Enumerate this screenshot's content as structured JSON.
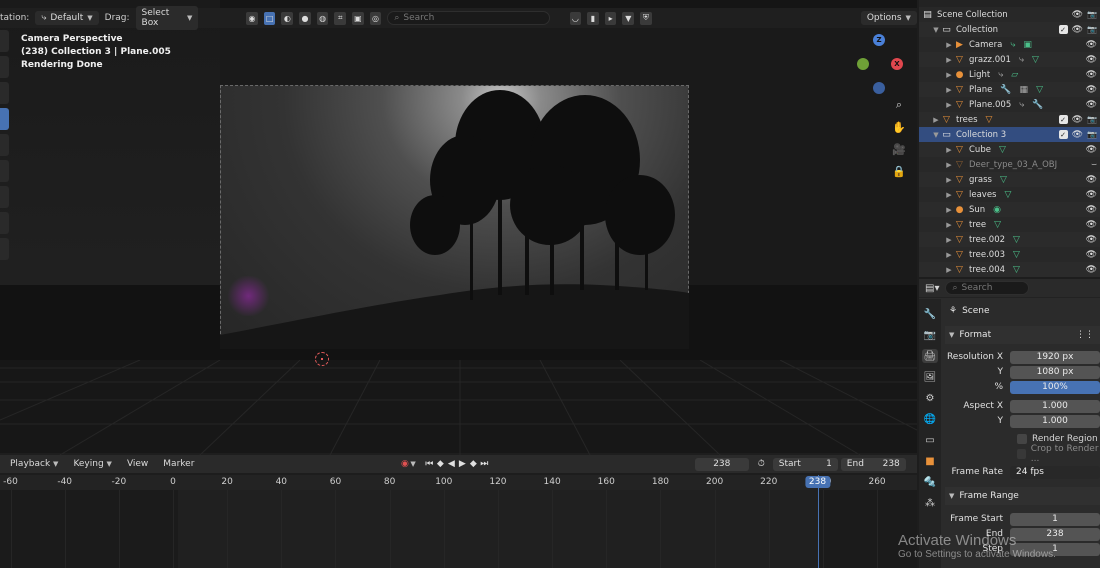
{
  "viewport": {
    "header": {
      "orientation_label": "tation:",
      "orientation_value": "Default",
      "drag_label": "Drag:",
      "drag_value": "Select Box",
      "search_placeholder": "Search",
      "options_label": "Options"
    },
    "overlay": {
      "line1": "Camera Perspective",
      "line2": "(238) Collection 3 | Plane.005",
      "line3": "Rendering Done"
    },
    "gizmo": {
      "z": "Z",
      "x": "X",
      "y": "Y"
    }
  },
  "timeline": {
    "menus": [
      "Playback",
      "Keying",
      "View",
      "Marker"
    ],
    "current_frame": "238",
    "start_label": "Start",
    "start_value": "1",
    "end_label": "End",
    "end_value": "238",
    "ruler_ticks": [
      "-60",
      "-40",
      "-20",
      "0",
      "20",
      "40",
      "60",
      "80",
      "100",
      "120",
      "140",
      "160",
      "180",
      "200",
      "220",
      "240",
      "260"
    ],
    "playhead": "238"
  },
  "outliner": {
    "search_placeholder": "Search",
    "rows": [
      {
        "label": "Scene Collection",
        "type": "scene"
      },
      {
        "label": "Collection",
        "type": "collection"
      },
      {
        "label": "Camera",
        "type": "camera"
      },
      {
        "label": "grazz.001",
        "type": "mesh"
      },
      {
        "label": "Light",
        "type": "light"
      },
      {
        "label": "Plane",
        "type": "mesh"
      },
      {
        "label": "Plane.005",
        "type": "mesh"
      },
      {
        "label": "trees",
        "type": "mesh"
      },
      {
        "label": "Collection 3",
        "type": "collection"
      },
      {
        "label": "Cube",
        "type": "mesh"
      },
      {
        "label": "Deer_type_03_A_OBJ",
        "type": "mesh"
      },
      {
        "label": "grass",
        "type": "mesh"
      },
      {
        "label": "leaves",
        "type": "mesh"
      },
      {
        "label": "Sun",
        "type": "light"
      },
      {
        "label": "tree",
        "type": "mesh"
      },
      {
        "label": "tree.002",
        "type": "mesh"
      },
      {
        "label": "tree.003",
        "type": "mesh"
      },
      {
        "label": "tree.004",
        "type": "mesh"
      }
    ]
  },
  "properties": {
    "search_placeholder": "Search",
    "scene_label": "Scene",
    "format_section": "Format",
    "resolution_x_label": "Resolution X",
    "resolution_x": "1920 px",
    "y_label": "Y",
    "resolution_y": "1080 px",
    "percent_label": "%",
    "percent": "100%",
    "aspect_x_label": "Aspect X",
    "aspect_x": "1.000",
    "aspect_y_label": "Y",
    "aspect_y": "1.000",
    "render_region": "Render Region",
    "crop_to_render": "Crop to Render ...",
    "frame_rate_label": "Frame Rate",
    "frame_rate": "24 fps",
    "frame_range_section": "Frame Range",
    "frame_start_label": "Frame Start",
    "frame_start": "1",
    "end_label": "End",
    "end": "238",
    "step_label": "Step",
    "step": "1"
  },
  "watermark": {
    "line1": "Activate Windows",
    "line2": "Go to Settings to activate Windows."
  },
  "colors": {
    "accent": "#4772b3",
    "selection": "#334d80",
    "axis_x": "#e0474e",
    "axis_y": "#6fa037",
    "axis_z": "#4a80d8"
  }
}
